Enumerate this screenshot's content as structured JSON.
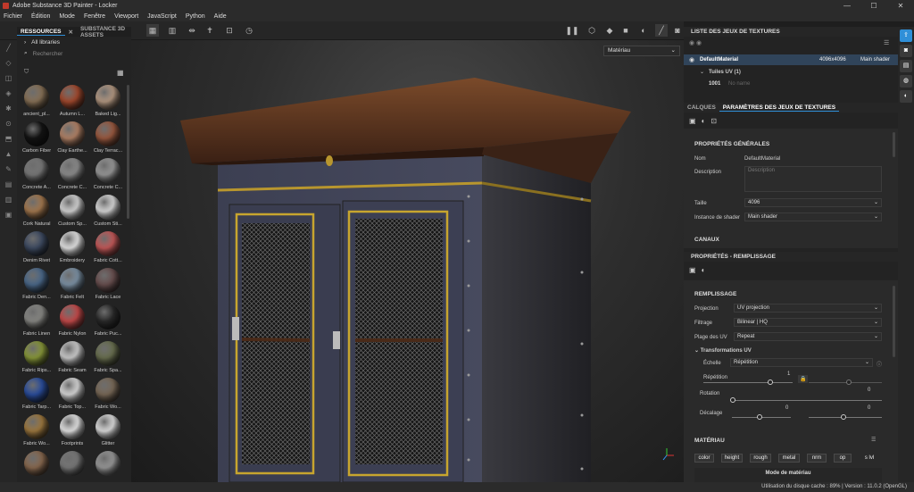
{
  "window": {
    "title": "Adobe Substance 3D Painter - Locker",
    "minimize": "—",
    "maximize": "☐",
    "close": "✕"
  },
  "menu": [
    "Fichier",
    "Édition",
    "Mode",
    "Fenêtre",
    "Viewport",
    "JavaScript",
    "Python",
    "Aide"
  ],
  "viewport": {
    "material_mode": "Matériau"
  },
  "assets": {
    "tabs": [
      "RESSOURCES",
      "SUBSTANCE 3D ASSETS"
    ],
    "tree_label": "All libraries",
    "search_placeholder": "Rechercher",
    "items": [
      {
        "name": "ancient_pl...",
        "color": "#8a7358"
      },
      {
        "name": "Autumn L...",
        "color": "#a54a2e"
      },
      {
        "name": "Baked Lig...",
        "color": "#b79b84"
      },
      {
        "name": "Carbon Fiber",
        "color": "#141414"
      },
      {
        "name": "Clay Earthe...",
        "color": "#b58468"
      },
      {
        "name": "Clay Terrac...",
        "color": "#9c5a40"
      },
      {
        "name": "Concrete A...",
        "color": "#7a7a7a"
      },
      {
        "name": "Concrete C...",
        "color": "#8f8f8f"
      },
      {
        "name": "Concrete C...",
        "color": "#9a9a9a"
      },
      {
        "name": "Cork Natural",
        "color": "#a67a50"
      },
      {
        "name": "Custom Sp...",
        "color": "#d8d8d8"
      },
      {
        "name": "Custom Sti...",
        "color": "#dcdcdc"
      },
      {
        "name": "Denim Rivet",
        "color": "#3f4c63"
      },
      {
        "name": "Embroidery",
        "color": "#e8e8e8"
      },
      {
        "name": "Fabric Cott...",
        "color": "#c75a5a"
      },
      {
        "name": "Fabric Den...",
        "color": "#4c6a8c"
      },
      {
        "name": "Fabric Felt",
        "color": "#7e94a8"
      },
      {
        "name": "Fabric Lace",
        "color": "#6a5050"
      },
      {
        "name": "Fabric Linen",
        "color": "#8a8a86"
      },
      {
        "name": "Fabric Nylon",
        "color": "#c84b4b"
      },
      {
        "name": "Fabric Puc...",
        "color": "#2b2b2b"
      },
      {
        "name": "Fabric Rips...",
        "color": "#8a9a3a"
      },
      {
        "name": "Fabric Seam",
        "color": "#d0d0d0"
      },
      {
        "name": "Fabric Spa...",
        "color": "#6a7050"
      },
      {
        "name": "Fabric Tarp...",
        "color": "#2b4fa0"
      },
      {
        "name": "Fabric Top...",
        "color": "#dcdcdc"
      },
      {
        "name": "Fabric Wo...",
        "color": "#7a6a58"
      },
      {
        "name": "Fabric Wo...",
        "color": "#a07a40"
      },
      {
        "name": "Footprints",
        "color": "#e8e8e8"
      },
      {
        "name": "Glitter",
        "color": "#e0e0e0"
      },
      {
        "name": "",
        "color": "#8a6a50"
      },
      {
        "name": "",
        "color": "#7a7a7a"
      },
      {
        "name": "",
        "color": "#9a9a9a"
      }
    ]
  },
  "texture_sets": {
    "header": "LISTE DES JEUX DE TEXTURES",
    "row": {
      "name": "DefaultMaterial",
      "size": "4096x4096",
      "shader": "Main shader"
    },
    "uv": {
      "label": "Tuiles UV (1)",
      "tile": "1001",
      "tile_name": "No name"
    }
  },
  "params": {
    "tabs": [
      "CALQUES",
      "PARAMÈTRES DES JEUX DE TEXTURES"
    ],
    "section_general": "PROPRIÉTÉS GÉNÉRALES",
    "name_label": "Nom",
    "name_value": "DefaultMaterial",
    "desc_label": "Description",
    "desc_placeholder": "Description",
    "size_label": "Taille",
    "size_value": "4096",
    "shader_label": "Instance de shader",
    "shader_value": "Main shader",
    "section_channels": "CANAUX"
  },
  "fill": {
    "header": "PROPRIÉTÉS - REMPLISSAGE",
    "section": "REMPLISSAGE",
    "projection_label": "Projection",
    "projection_value": "UV projection",
    "filter_label": "Filtrage",
    "filter_value": "Bilinear | HQ",
    "wrap_label": "Plage des UV",
    "wrap_value": "Repeat",
    "uv_transforms": "Transformations UV",
    "scale_label": "Échelle",
    "scale_value": "Répétition",
    "repeat_label": "Répétition",
    "repeat_value": "1",
    "rotation_label": "Rotation",
    "rotation_value": "0",
    "offset_label": "Décalage",
    "offset_value_a": "0",
    "offset_value_b": "0",
    "section_material": "MATÉRIAU",
    "channels": [
      "color",
      "height",
      "rough",
      "metal",
      "nrm",
      "op",
      "s lvl"
    ],
    "material_mode": "Mode de matériau"
  },
  "status": {
    "text": "Utilisation du disque cache :   89% | Version : 11.0.2 (OpenGL)"
  }
}
